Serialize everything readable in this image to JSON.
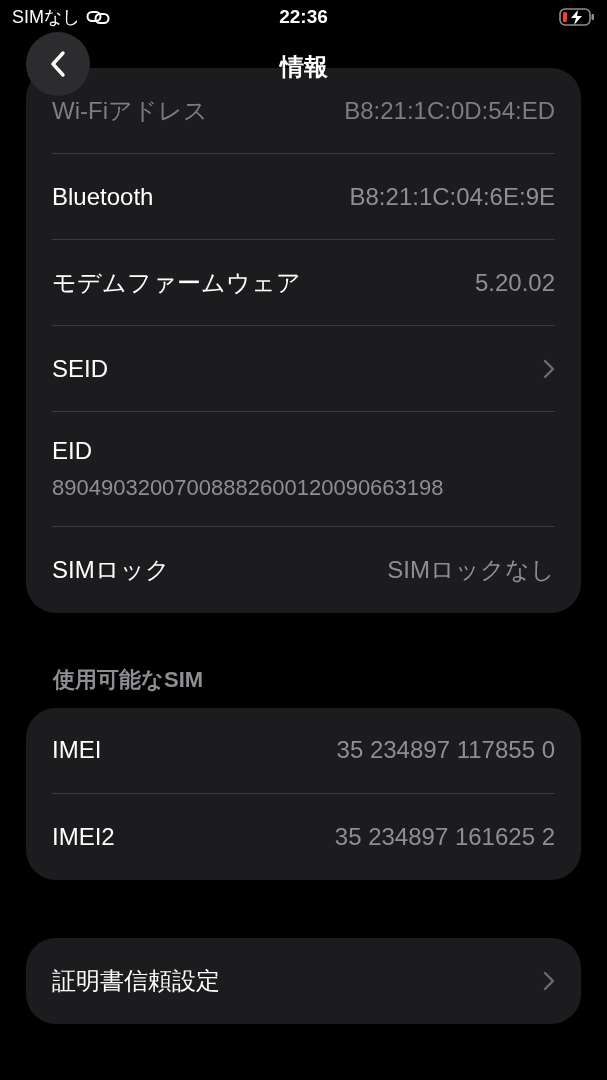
{
  "status_bar": {
    "carrier": "SIMなし",
    "time": "22:36",
    "battery_charging": true
  },
  "nav": {
    "title": "情報"
  },
  "groups": [
    {
      "rows": [
        {
          "kind": "value",
          "label": "Wi-Fiアドレス",
          "value": "B8:21:1C:0D:54:ED",
          "dimmed": true
        },
        {
          "kind": "value",
          "label": "Bluetooth",
          "value": "B8:21:1C:04:6E:9E",
          "dimmed": false
        },
        {
          "kind": "value",
          "label": "モデムファームウェア",
          "value": "5.20.02",
          "dimmed": false
        },
        {
          "kind": "link",
          "label": "SEID",
          "dimmed": false
        },
        {
          "kind": "stacked",
          "label": "EID",
          "value": "89049032007008882600120090663198",
          "dimmed": false
        },
        {
          "kind": "value",
          "label": "SIMロック",
          "value": "SIMロックなし",
          "dimmed": false
        }
      ]
    },
    {
      "header": "使用可能なSIM",
      "rows": [
        {
          "kind": "value",
          "label": "IMEI",
          "value": "35 234897 117855 0",
          "dimmed": false
        },
        {
          "kind": "value",
          "label": "IMEI2",
          "value": "35 234897 161625 2",
          "dimmed": false
        }
      ]
    },
    {
      "rows": [
        {
          "kind": "link",
          "label": "証明書信頼設定",
          "dimmed": false
        }
      ]
    }
  ]
}
